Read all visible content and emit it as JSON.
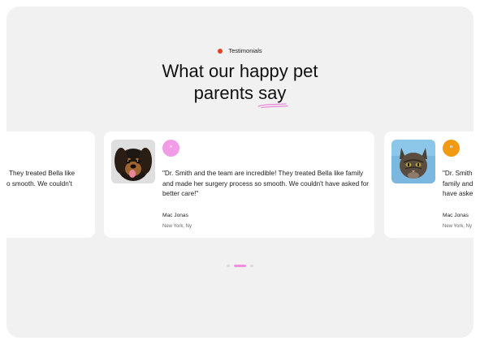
{
  "section": {
    "eyebrow": "Testimonials",
    "headline_line1": "What our happy pet",
    "headline_line2_start": "parents ",
    "headline_highlight": "say"
  },
  "testimonials": [
    {
      "partial_line1": "They treated Bella like",
      "partial_line2": "o smooth. We couldn't"
    },
    {
      "quote": "\"Dr. Smith and the team are incredible! They treated Bella like family and made her surgery process so smooth. We couldn't have asked for better care!\"",
      "author": "Mac Jonas",
      "location": "New York, Ny",
      "badge_icon": "quote-icon",
      "badge_color": "#f09ce6"
    },
    {
      "quote_line1": "\"Dr. Smith",
      "quote_line2": "family and",
      "quote_line3": "have aske",
      "author": "Mac Jonas",
      "location": "New York, Ny",
      "badge_icon": "quote-icon",
      "badge_color": "#f29a12"
    }
  ],
  "carousel": {
    "slide_count": 3,
    "active_index": 1
  },
  "colors": {
    "accent_dot": "#e8401c",
    "underline": "#e98ad8"
  }
}
